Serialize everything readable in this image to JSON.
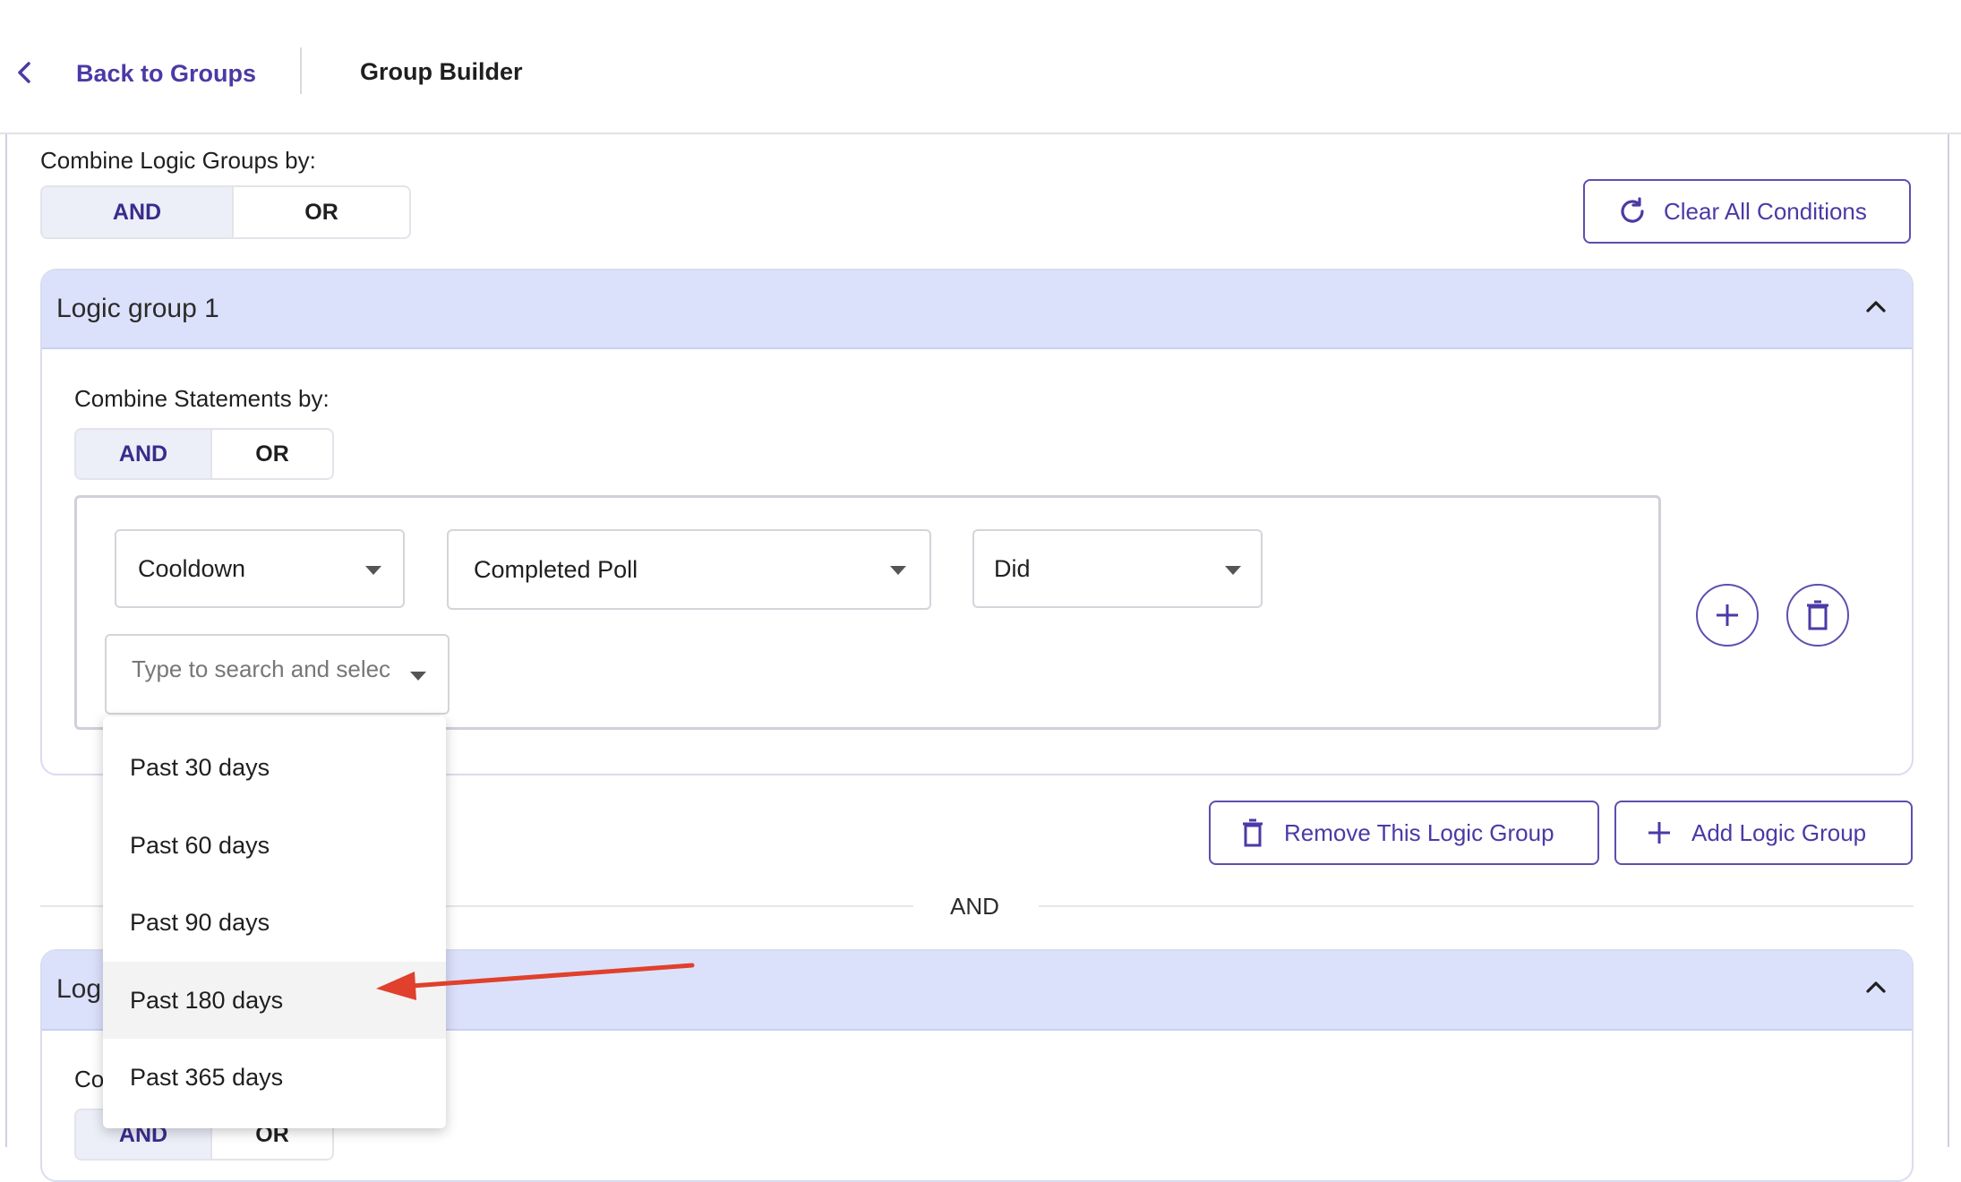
{
  "header": {
    "back_label": "Back to Groups",
    "title": "Group Builder"
  },
  "combine_groups": {
    "label": "Combine Logic Groups by:",
    "options": [
      "AND",
      "OR"
    ],
    "selected": "AND"
  },
  "clear_button": {
    "label": "Clear All Conditions"
  },
  "logic_group_1": {
    "title": "Logic group 1",
    "combine_label": "Combine Statements by:",
    "combine_options": [
      "AND",
      "OR"
    ],
    "combine_selected": "AND",
    "statement": {
      "field_1": "Cooldown",
      "field_2": "Completed Poll",
      "field_3": "Did",
      "search_placeholder": "Type to search and selec"
    }
  },
  "group_actions": {
    "remove_label": "Remove This Logic Group",
    "add_label": "Add Logic Group"
  },
  "separator": {
    "label": "AND"
  },
  "logic_group_2": {
    "title": "Log",
    "combine_label": "Co",
    "combine_options": [
      "AND",
      "OR"
    ]
  },
  "dropdown": {
    "options": [
      "Past 30 days",
      "Past 60 days",
      "Past 90 days",
      "Past 180 days",
      "Past 365 days"
    ],
    "highlighted": "Past 180 days"
  },
  "colors": {
    "accent": "#4a3aa6",
    "header_bg": "#dce1fb",
    "annotation_arrow": "#e0402c"
  },
  "icons": [
    "chevron-left-icon",
    "refresh-icon",
    "chevron-up-icon",
    "caret-down-icon",
    "plus-icon",
    "trash-icon"
  ]
}
